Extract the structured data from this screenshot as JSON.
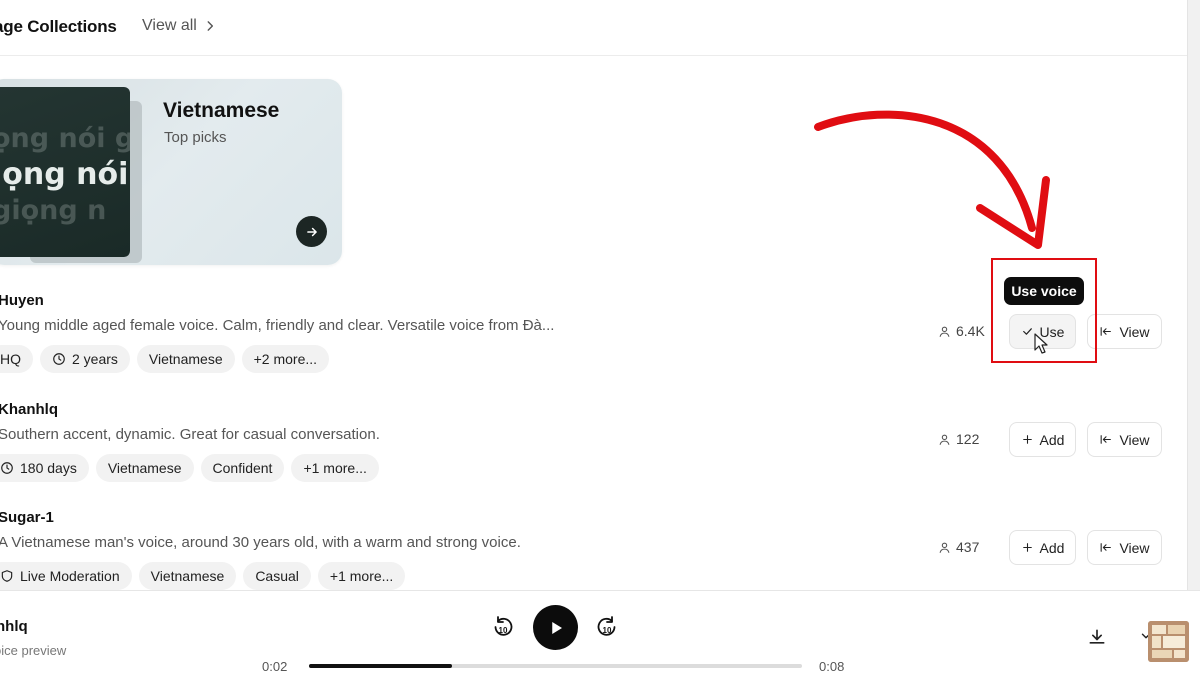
{
  "header": {
    "title": "age Collections",
    "view_all": "View all"
  },
  "collection": {
    "title": "Vietnamese",
    "subtitle": "Top picks",
    "card_words": [
      "ọng nói g",
      "iọng nói",
      "giọng n"
    ]
  },
  "voices": [
    {
      "name": "Huyen",
      "description": "Young middle aged female voice. Calm, friendly and clear. Versatile voice from Đà...",
      "tags": [
        {
          "label": "HQ",
          "icon": ""
        },
        {
          "label": "2 years",
          "icon": "clock-icon"
        },
        {
          "label": "Vietnamese",
          "icon": ""
        },
        {
          "label": "+2 more...",
          "icon": ""
        }
      ],
      "users": "6.4K",
      "primary_label": "Use",
      "primary_icon": "check-icon",
      "view_label": "View"
    },
    {
      "name": "Khanhlq",
      "description": "Southern accent, dynamic. Great for casual conversation.",
      "tags": [
        {
          "label": "180 days",
          "icon": "clock-icon"
        },
        {
          "label": "Vietnamese",
          "icon": ""
        },
        {
          "label": "Confident",
          "icon": ""
        },
        {
          "label": "+1 more...",
          "icon": ""
        }
      ],
      "users": "122",
      "primary_label": "Add",
      "primary_icon": "plus-icon",
      "view_label": "View"
    },
    {
      "name": "Sugar-1",
      "description": "A Vietnamese man's voice, around 30 years old, with a warm and strong voice.",
      "tags": [
        {
          "label": "Live Moderation",
          "icon": "shield-icon"
        },
        {
          "label": "Vietnamese",
          "icon": ""
        },
        {
          "label": "Casual",
          "icon": ""
        },
        {
          "label": "+1 more...",
          "icon": ""
        }
      ],
      "users": "437",
      "primary_label": "Add",
      "primary_icon": "plus-icon",
      "view_label": "View"
    }
  ],
  "tooltip": "Use voice",
  "player": {
    "name": "nhlq",
    "subtitle": "oice preview",
    "current_time": "0:02",
    "total_time": "0:08",
    "progress": 0.29,
    "skip_back_label": "10",
    "skip_forward_label": "10"
  },
  "colors": {
    "annotation_red": "#e00d12",
    "tooltip_bg": "#0d0d0d",
    "play_button": "#0c0c0c"
  }
}
